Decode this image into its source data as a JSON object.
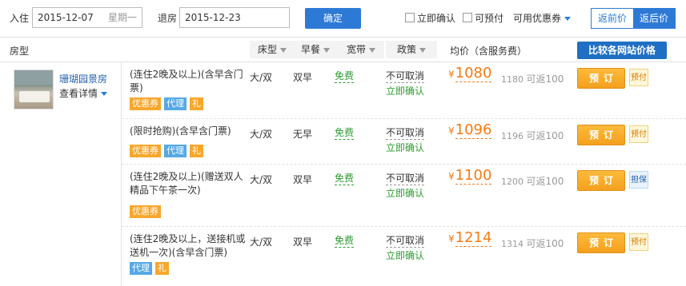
{
  "filter": {
    "checkin_label": "入住",
    "checkin_date": "2015-12-07",
    "checkin_weekday": "星期一",
    "checkout_label": "退房",
    "checkout_date": "2015-12-23",
    "confirm_label": "确定",
    "instant_confirm_label": "立即确认",
    "prepay_label": "可预付",
    "coupon_label": "可用优惠券",
    "price_before_label": "返前价",
    "price_after_label": "返后价"
  },
  "header": {
    "room_type": "房型",
    "bed": "床型",
    "breakfast": "早餐",
    "broadband": "宽带",
    "policy": "政策",
    "avg_price": "均价（含服务费）",
    "compare_label": "比较各网站价格"
  },
  "room": {
    "name": "珊瑚园景房",
    "detail_label": "查看详情"
  },
  "rates": [
    {
      "name": "(连住2晚及以上)(含早含门票)",
      "tags": [
        "优惠券",
        "代理",
        "礼"
      ],
      "bed": "大/双",
      "breakfast": "双早",
      "broadband": "免费",
      "policy": "不可取消",
      "confirm": "立即确认",
      "currency": "¥",
      "price": "1080",
      "orig_price": "1180",
      "cashback": "可返100",
      "book_label": "预订",
      "pay_type": "预付"
    },
    {
      "name": "(限时抢购)(含早含门票)",
      "tags": [
        "优惠券",
        "代理",
        "礼"
      ],
      "bed": "大/双",
      "breakfast": "无早",
      "broadband": "免费",
      "policy": "不可取消",
      "confirm": "立即确认",
      "currency": "¥",
      "price": "1096",
      "orig_price": "1196",
      "cashback": "可返100",
      "book_label": "预订",
      "pay_type": "预付"
    },
    {
      "name": "(连住2晚及以上)(赠送双人精品下午茶一次)",
      "tags": [
        "优惠券"
      ],
      "bed": "大/双",
      "breakfast": "双早",
      "broadband": "免费",
      "policy": "不可取消",
      "confirm": "立即确认",
      "currency": "¥",
      "price": "1100",
      "orig_price": "1200",
      "cashback": "可返100",
      "book_label": "预订",
      "pay_type": "担保"
    },
    {
      "name": "(连住2晚及以上，送接机或送机一次)(含早含门票)",
      "tags": [
        "代理",
        "礼"
      ],
      "bed": "大/双",
      "breakfast": "双早",
      "broadband": "免费",
      "policy": "不可取消",
      "confirm": "立即确认",
      "currency": "¥",
      "price": "1214",
      "orig_price": "1314",
      "cashback": "可返100",
      "book_label": "预订",
      "pay_type": "预付"
    }
  ],
  "colors": {
    "brand_blue": "#2d7ad6",
    "price_orange": "#f67a12",
    "free_green": "#2e9b31",
    "book_orange": "#f3a01e"
  }
}
